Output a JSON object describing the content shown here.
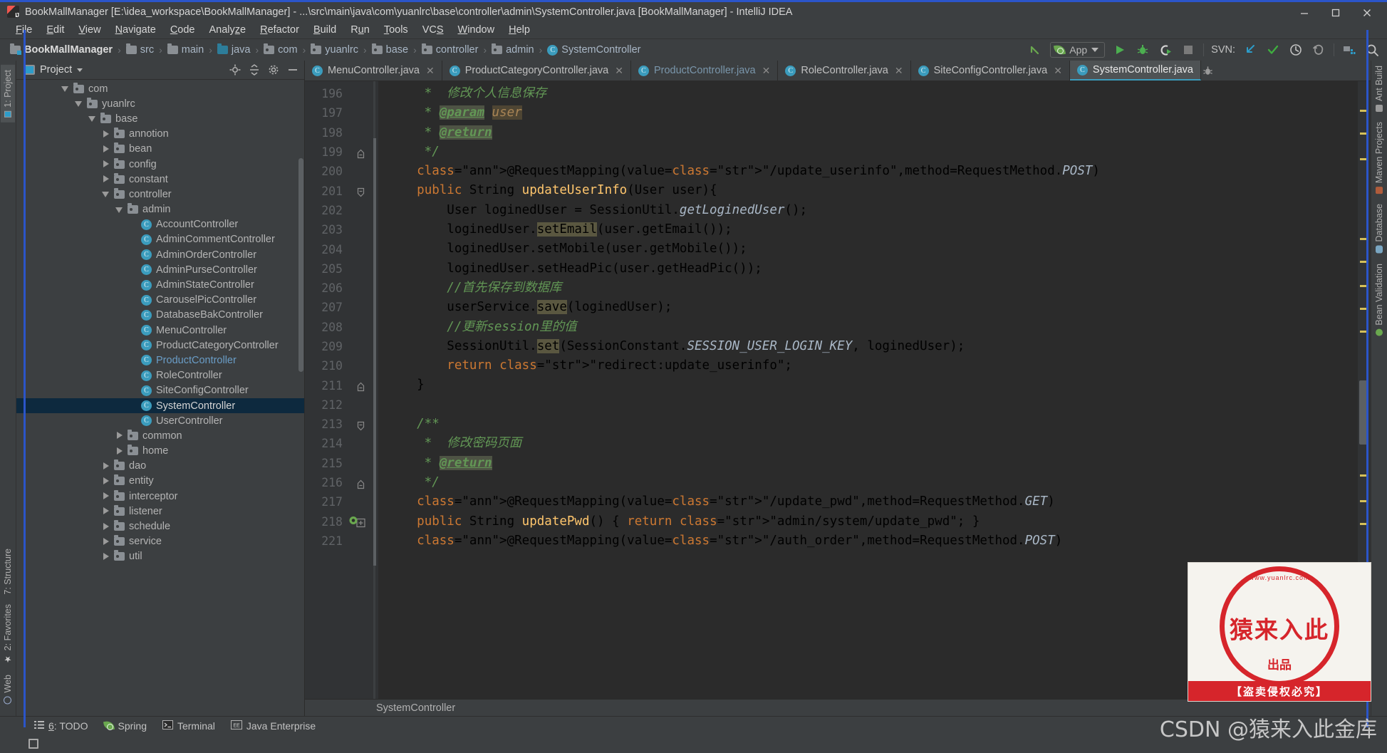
{
  "window": {
    "title": "BookMallManager [E:\\idea_workspace\\BookMallManager] - ...\\src\\main\\java\\com\\yuanlrc\\base\\controller\\admin\\SystemController.java [BookMallManager] - IntelliJ IDEA",
    "minimize_label": "minimize-icon",
    "maximize_label": "maximize-icon",
    "close_label": "close-icon",
    "accent_border": "#2b55c9"
  },
  "menubar": {
    "items": [
      {
        "label": "File",
        "mnemonic": "F"
      },
      {
        "label": "Edit",
        "mnemonic": "E"
      },
      {
        "label": "View",
        "mnemonic": "V"
      },
      {
        "label": "Navigate",
        "mnemonic": "N"
      },
      {
        "label": "Code",
        "mnemonic": "C"
      },
      {
        "label": "Analyze",
        "mnemonic": "z"
      },
      {
        "label": "Refactor",
        "mnemonic": "R"
      },
      {
        "label": "Build",
        "mnemonic": "B"
      },
      {
        "label": "Run",
        "mnemonic": "u"
      },
      {
        "label": "Tools",
        "mnemonic": "T"
      },
      {
        "label": "VCS",
        "mnemonic": "S"
      },
      {
        "label": "Window",
        "mnemonic": "W"
      },
      {
        "label": "Help",
        "mnemonic": "H"
      }
    ]
  },
  "breadcrumb": {
    "items": [
      {
        "label": "BookMallManager",
        "icon": "project-folder-icon",
        "kind": "root"
      },
      {
        "label": "src",
        "icon": "folder-icon",
        "kind": "folder"
      },
      {
        "label": "main",
        "icon": "folder-icon",
        "kind": "folder"
      },
      {
        "label": "java",
        "icon": "source-folder-icon",
        "kind": "source"
      },
      {
        "label": "com",
        "icon": "package-icon",
        "kind": "package"
      },
      {
        "label": "yuanlrc",
        "icon": "package-icon",
        "kind": "package"
      },
      {
        "label": "base",
        "icon": "package-icon",
        "kind": "package"
      },
      {
        "label": "controller",
        "icon": "package-icon",
        "kind": "package"
      },
      {
        "label": "admin",
        "icon": "package-icon",
        "kind": "package"
      },
      {
        "label": "SystemController",
        "icon": "class-icon",
        "kind": "class"
      }
    ],
    "separator": "›"
  },
  "toolbar": {
    "back_icon": "undo-arrow-icon",
    "run_config": {
      "label": "App",
      "icon": "spring-leaf-icon",
      "dropdown": "chevron-down-icon"
    },
    "run_icon": "run-play-icon",
    "debug_icon": "debug-bug-icon",
    "coverage_icon": "run-with-coverage-icon",
    "stop_icon": "stop-square-icon",
    "vcs_label": "SVN:",
    "update_icon": "vcs-update-icon",
    "commit_icon": "vcs-commit-checkmark-icon",
    "history_icon": "vcs-history-clock-icon",
    "rollback_icon": "vcs-rollback-icon",
    "project_structure_icon": "project-structure-icon",
    "search_icon": "search-everywhere-icon"
  },
  "left_rail": {
    "tabs": [
      {
        "label": "1: Project",
        "selected": true,
        "icon": "project-tool-icon"
      },
      {
        "label": "7: Structure",
        "selected": false,
        "icon": "structure-tool-icon"
      },
      {
        "label": "2: Favorites",
        "selected": false,
        "icon": "favorites-star-icon"
      },
      {
        "label": "Web",
        "selected": false,
        "icon": "web-globe-icon"
      }
    ]
  },
  "right_rail": {
    "tabs": [
      {
        "label": "Ant Build",
        "icon": "ant-icon"
      },
      {
        "label": "Maven Projects",
        "icon": "maven-icon"
      },
      {
        "label": "Database",
        "icon": "database-icon"
      },
      {
        "label": "Bean Validation",
        "icon": "bean-validation-icon"
      }
    ]
  },
  "project_panel": {
    "title": "Project",
    "dropdown_icon": "chevron-down-icon",
    "locate_icon": "scroll-from-source-icon",
    "collapse_icon": "collapse-all-icon",
    "settings_icon": "gear-icon",
    "hide_icon": "hide-minus-icon",
    "tree": [
      {
        "label": "com",
        "depth": 3,
        "toggle": "expanded",
        "icon": "package-icon",
        "selected": false
      },
      {
        "label": "yuanlrc",
        "depth": 4,
        "toggle": "expanded",
        "icon": "package-icon",
        "selected": false
      },
      {
        "label": "base",
        "depth": 5,
        "toggle": "expanded",
        "icon": "package-icon",
        "selected": false
      },
      {
        "label": "annotion",
        "depth": 6,
        "toggle": "collapsed",
        "icon": "package-icon",
        "selected": false
      },
      {
        "label": "bean",
        "depth": 6,
        "toggle": "collapsed",
        "icon": "package-icon",
        "selected": false
      },
      {
        "label": "config",
        "depth": 6,
        "toggle": "collapsed",
        "icon": "package-icon",
        "selected": false
      },
      {
        "label": "constant",
        "depth": 6,
        "toggle": "collapsed",
        "icon": "package-icon",
        "selected": false
      },
      {
        "label": "controller",
        "depth": 6,
        "toggle": "expanded",
        "icon": "package-icon",
        "selected": false
      },
      {
        "label": "admin",
        "depth": 7,
        "toggle": "expanded",
        "icon": "package-icon",
        "selected": false
      },
      {
        "label": "AccountController",
        "depth": 8,
        "toggle": "none",
        "icon": "class-icon",
        "selected": false
      },
      {
        "label": "AdminCommentController",
        "depth": 8,
        "toggle": "none",
        "icon": "class-icon",
        "selected": false
      },
      {
        "label": "AdminOrderController",
        "depth": 8,
        "toggle": "none",
        "icon": "class-icon",
        "selected": false
      },
      {
        "label": "AdminPurseController",
        "depth": 8,
        "toggle": "none",
        "icon": "class-icon",
        "selected": false
      },
      {
        "label": "AdminStateController",
        "depth": 8,
        "toggle": "none",
        "icon": "class-icon",
        "selected": false
      },
      {
        "label": "CarouselPicController",
        "depth": 8,
        "toggle": "none",
        "icon": "class-icon",
        "selected": false
      },
      {
        "label": "DatabaseBakController",
        "depth": 8,
        "toggle": "none",
        "icon": "class-icon",
        "selected": false
      },
      {
        "label": "MenuController",
        "depth": 8,
        "toggle": "none",
        "icon": "class-icon",
        "selected": false
      },
      {
        "label": "ProductCategoryController",
        "depth": 8,
        "toggle": "none",
        "icon": "class-icon",
        "selected": false
      },
      {
        "label": "ProductController",
        "depth": 8,
        "toggle": "none",
        "icon": "class-icon",
        "selected": false,
        "muted": true
      },
      {
        "label": "RoleController",
        "depth": 8,
        "toggle": "none",
        "icon": "class-icon",
        "selected": false
      },
      {
        "label": "SiteConfigController",
        "depth": 8,
        "toggle": "none",
        "icon": "class-icon",
        "selected": false
      },
      {
        "label": "SystemController",
        "depth": 8,
        "toggle": "none",
        "icon": "class-icon",
        "selected": true
      },
      {
        "label": "UserController",
        "depth": 8,
        "toggle": "none",
        "icon": "class-icon",
        "selected": false
      },
      {
        "label": "common",
        "depth": 7,
        "toggle": "collapsed",
        "icon": "package-icon",
        "selected": false
      },
      {
        "label": "home",
        "depth": 7,
        "toggle": "collapsed",
        "icon": "package-icon",
        "selected": false
      },
      {
        "label": "dao",
        "depth": 6,
        "toggle": "collapsed",
        "icon": "package-icon",
        "selected": false
      },
      {
        "label": "entity",
        "depth": 6,
        "toggle": "collapsed",
        "icon": "package-icon",
        "selected": false
      },
      {
        "label": "interceptor",
        "depth": 6,
        "toggle": "collapsed",
        "icon": "package-icon",
        "selected": false
      },
      {
        "label": "listener",
        "depth": 6,
        "toggle": "collapsed",
        "icon": "package-icon",
        "selected": false
      },
      {
        "label": "schedule",
        "depth": 6,
        "toggle": "collapsed",
        "icon": "package-icon",
        "selected": false
      },
      {
        "label": "service",
        "depth": 6,
        "toggle": "collapsed",
        "icon": "package-icon",
        "selected": false
      },
      {
        "label": "util",
        "depth": 6,
        "toggle": "collapsed",
        "icon": "package-icon",
        "selected": false
      }
    ]
  },
  "editor": {
    "tabs": [
      {
        "label": "MenuController.java",
        "active": false,
        "muted": false,
        "closable": true
      },
      {
        "label": "ProductCategoryController.java",
        "active": false,
        "muted": false,
        "closable": true
      },
      {
        "label": "ProductController.java",
        "active": false,
        "muted": true,
        "closable": true
      },
      {
        "label": "RoleController.java",
        "active": false,
        "muted": false,
        "closable": true
      },
      {
        "label": "SiteConfigController.java",
        "active": false,
        "muted": false,
        "closable": true
      },
      {
        "label": "SystemController.java",
        "active": true,
        "muted": false,
        "closable": false
      }
    ],
    "tab_icon": "java-class-icon",
    "close_icon": "close-icon",
    "bug_icon": "debug-bug-icon",
    "footer_breadcrumb": "SystemController",
    "first_line_number": 196,
    "lines": [
      {
        "n": "196",
        "fold": "none",
        "text": "     *  修改个人信息保存"
      },
      {
        "n": "197",
        "fold": "none",
        "text": "     * @param user"
      },
      {
        "n": "198",
        "fold": "none",
        "text": "     * @return"
      },
      {
        "n": "199",
        "fold": "end",
        "text": "     */"
      },
      {
        "n": "200",
        "fold": "none",
        "text": "    @RequestMapping(value=\"/update_userinfo\",method=RequestMethod.POST)"
      },
      {
        "n": "201",
        "fold": "start",
        "text": "    public String updateUserInfo(User user){"
      },
      {
        "n": "202",
        "fold": "none",
        "text": "        User loginedUser = SessionUtil.getLoginedUser();"
      },
      {
        "n": "203",
        "fold": "none",
        "text": "        loginedUser.setEmail(user.getEmail());"
      },
      {
        "n": "204",
        "fold": "none",
        "text": "        loginedUser.setMobile(user.getMobile());"
      },
      {
        "n": "205",
        "fold": "none",
        "text": "        loginedUser.setHeadPic(user.getHeadPic());"
      },
      {
        "n": "206",
        "fold": "none",
        "text": "        //首先保存到数据库"
      },
      {
        "n": "207",
        "fold": "none",
        "text": "        userService.save(loginedUser);"
      },
      {
        "n": "208",
        "fold": "none",
        "text": "        //更新session里的值"
      },
      {
        "n": "209",
        "fold": "none",
        "text": "        SessionUtil.set(SessionConstant.SESSION_USER_LOGIN_KEY, loginedUser);"
      },
      {
        "n": "210",
        "fold": "none",
        "text": "        return \"redirect:update_userinfo\";"
      },
      {
        "n": "211",
        "fold": "end",
        "text": "    }"
      },
      {
        "n": "212",
        "fold": "none",
        "text": ""
      },
      {
        "n": "213",
        "fold": "start",
        "text": "    /**"
      },
      {
        "n": "214",
        "fold": "none",
        "text": "     *  修改密码页面"
      },
      {
        "n": "215",
        "fold": "none",
        "text": "     * @return"
      },
      {
        "n": "216",
        "fold": "end",
        "text": "     */"
      },
      {
        "n": "217",
        "fold": "none",
        "text": "    @RequestMapping(value=\"/update_pwd\",method=RequestMethod.GET)"
      },
      {
        "n": "218",
        "fold": "plus",
        "text": "    public String updatePwd() { return \"admin/system/update_pwd\"; }"
      },
      {
        "n": "221",
        "fold": "none",
        "text": "    @RequestMapping(value=\"/auth_order\",method=RequestMethod.POST)"
      }
    ]
  },
  "bottom_bar": {
    "items": [
      {
        "label": "6: TODO",
        "mnemonic": "6",
        "icon": "todo-list-icon"
      },
      {
        "label": "Spring",
        "icon": "spring-leaf-icon"
      },
      {
        "label": "Terminal",
        "icon": "terminal-icon"
      },
      {
        "label": "Java Enterprise",
        "icon": "java-enterprise-icon"
      }
    ]
  },
  "status_bar": {
    "toggle_icon": "toggle-toolwindows-icon"
  },
  "watermark": {
    "stamp_top": "www.yuanlrc.com",
    "stamp_main": "猿来入此",
    "stamp_sub": "出品",
    "stamp_banner": "【盗卖侵权必究】",
    "csdn_text": "CSDN @猿来入此金库",
    "stamp_color": "#d6252b"
  },
  "colors": {
    "accent": "#3b9cbd",
    "selection": "#0d293e",
    "editor_bg": "#2b2b2b",
    "chrome_bg": "#3c3f41",
    "gutter_bg": "#313335"
  }
}
